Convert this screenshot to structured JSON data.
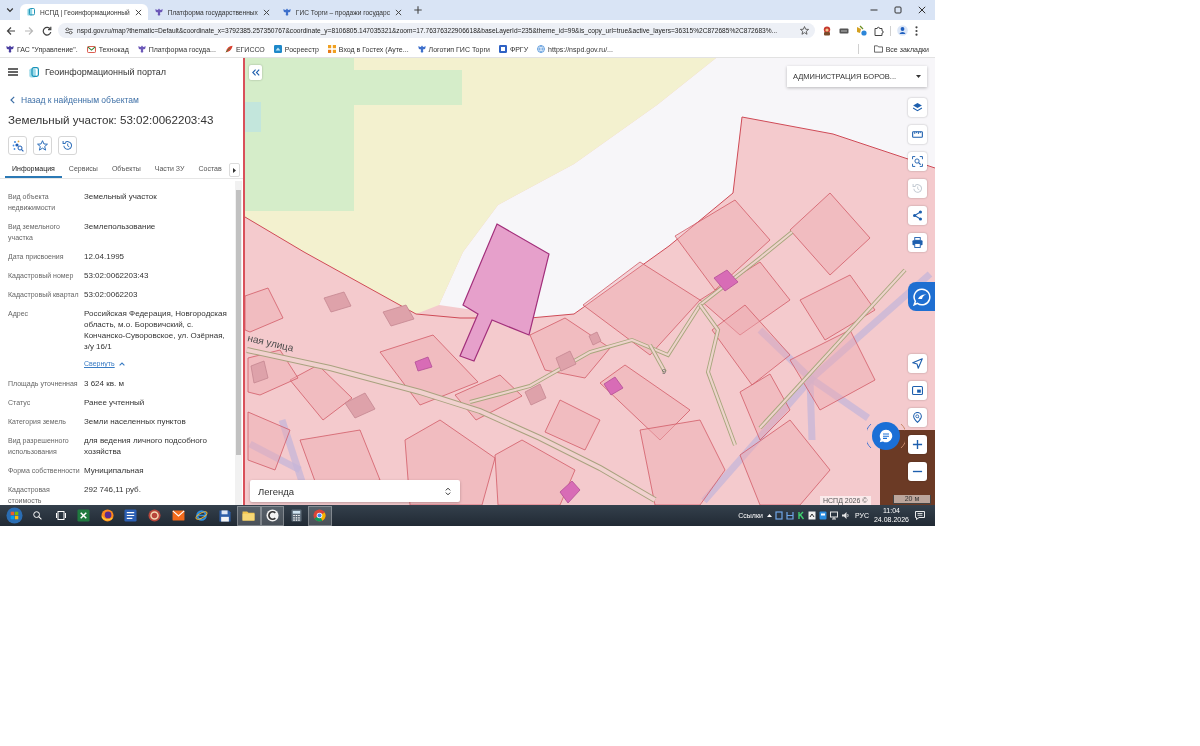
{
  "browser": {
    "tabs": [
      {
        "title": "НСПД | Геоинформационный",
        "selected": true
      },
      {
        "title": "Платформа государственных",
        "selected": false
      },
      {
        "title": "ГИС Торги – продажи государс",
        "selected": false
      }
    ],
    "nav": [
      {
        "kind": "back",
        "disabled": false
      },
      {
        "kind": "forward",
        "disabled": true
      },
      {
        "kind": "reload",
        "disabled": false
      }
    ],
    "address": "nspd.gov.ru/map?thematic=Default&coordinate_x=3792385.257350767&coordinate_y=8106805.147035321&zoom=17.76376322906618&baseLayerId=235&theme_id=99&is_copy_url=true&active_layers=36315%2C872685%2C872683%...",
    "bookmarks": [
      "ГАС \"Управление\".",
      "Технокад",
      "Платформа госуда...",
      "ЕГИССО",
      "Росреестр",
      "Вход в Гостех (Ауте...",
      "Логотип ГИС Торги",
      "ФРГУ",
      "https://nspd.gov.ru/..."
    ],
    "all_bookmarks": "Все закладки"
  },
  "portal": {
    "title": "Геоинформационный портал",
    "back_link": "Назад к найденным объектам",
    "heading": "Земельный участок: 53:02:0062203:43",
    "tabs": [
      {
        "label": "Информация",
        "selected": true
      },
      {
        "label": "Сервисы",
        "selected": false
      },
      {
        "label": "Объекты",
        "selected": false
      },
      {
        "label": "Части ЗУ",
        "selected": false
      },
      {
        "label": "Состав",
        "selected": false
      }
    ],
    "properties": [
      {
        "label": "Вид объекта недвижимости",
        "value": "Земельный участок"
      },
      {
        "label": "Вид земельного участка",
        "value": "Землепользование"
      },
      {
        "label": "Дата присвоения",
        "value": "12.04.1995"
      },
      {
        "label": "Кадастровый номер",
        "value": "53:02:0062203:43"
      },
      {
        "label": "Кадастровый квартал",
        "value": "53:02:0062203"
      },
      {
        "label": "Адрес",
        "value": "Российская Федерация, Новгородская область, м.о. Боровичский, с. Кончанско-Суворовское, ул. Озёрная, з/у 16/1",
        "link": "Свернуть"
      },
      {
        "label": "Площадь уточненная",
        "value": "3 624 кв. м"
      },
      {
        "label": "Статус",
        "value": "Ранее учтенный"
      },
      {
        "label": "Категория земель",
        "value": "Земли населенных пунктов"
      },
      {
        "label": "Вид разрешенного использования",
        "value": "для ведения личного подсобного хозяйства"
      },
      {
        "label": "Форма собственности",
        "value": "Муниципальная"
      },
      {
        "label": "Кадастровая стоимость",
        "value": "292 746,11 руб."
      }
    ]
  },
  "map": {
    "region": "АДМИНИСТРАЦИЯ БОРОВ...",
    "street_label": "ная улица",
    "house_number": "9",
    "tools": [
      {
        "kind": "layers",
        "disabled": false
      },
      {
        "kind": "ruler",
        "disabled": false
      },
      {
        "kind": "area-select",
        "disabled": false
      },
      {
        "kind": "history",
        "disabled": true
      },
      {
        "kind": "share",
        "disabled": false
      },
      {
        "kind": "print",
        "disabled": false
      }
    ],
    "nav_tools": [
      {
        "kind": "locate"
      },
      {
        "kind": "minimap"
      },
      {
        "kind": "place-search"
      },
      {
        "kind": "zoom-in"
      },
      {
        "kind": "zoom-out"
      }
    ],
    "legend": "Легенда",
    "attribution": "НСПД 2026 ©",
    "scale": "20 м"
  },
  "taskbar": {
    "apps": [
      {
        "kind": "sheet",
        "open": false
      },
      {
        "kind": "fox",
        "open": false
      },
      {
        "kind": "doc",
        "open": false
      },
      {
        "kind": "round",
        "open": false
      },
      {
        "kind": "mail",
        "open": false
      },
      {
        "kind": "ie",
        "open": false
      },
      {
        "kind": "floppy",
        "open": false
      },
      {
        "kind": "folder",
        "open": true
      },
      {
        "kind": "c-app",
        "open": true
      },
      {
        "kind": "calc",
        "open": false
      },
      {
        "kind": "chrome",
        "open": true
      }
    ],
    "links": "Ссылки",
    "language": "РУС",
    "time": "11:04",
    "date": "24.08.2026"
  }
}
